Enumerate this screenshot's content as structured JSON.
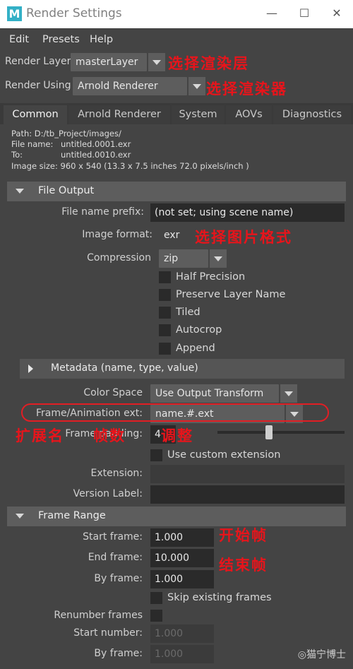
{
  "window": {
    "logo": "M",
    "title": "Render Settings",
    "minimize_glyph": "—",
    "maximize_glyph": "☐",
    "close_glyph": "✕"
  },
  "menubar": [
    "Edit",
    "Presets",
    "Help"
  ],
  "render_layer": {
    "label": "Render Layer",
    "value": "masterLayer"
  },
  "render_using": {
    "label": "Render Using",
    "value": "Arnold Renderer"
  },
  "annotations": {
    "layer": "选择渲染层",
    "renderer": "选择渲染器",
    "format": "选择图片格式",
    "ext_a": "扩展名",
    "ext_b": "帧数",
    "ext_c": "调整",
    "start": "开始帧",
    "end": "结束帧"
  },
  "tabs": [
    "Common",
    "Arnold Renderer",
    "System",
    "AOVs",
    "Diagnostics"
  ],
  "active_tab": "Common",
  "info": {
    "path": "Path: D:/tb_Project/images/",
    "file_name_label": "File name:",
    "file_name": "untitled.0001.exr",
    "to_label": "To:",
    "to": "untitled.0010.exr",
    "image_size": "Image size: 960 x 540 (13.3 x 7.5 inches 72.0 pixels/inch )"
  },
  "file_output": {
    "title": "File Output",
    "prefix_label": "File name prefix:",
    "prefix_value": "(not set; using scene name)",
    "format_label": "Image format:",
    "format_value": "exr",
    "compression_label": "Compression",
    "compression_value": "zip",
    "checkboxes": [
      "Half Precision",
      "Preserve Layer Name",
      "Tiled",
      "Autocrop",
      "Append"
    ],
    "metadata": "Metadata (name, type, value)",
    "color_space_label": "Color Space",
    "color_space_value": "Use Output Transform",
    "frame_ext_label": "Frame/Animation ext:",
    "frame_ext_value": "name.#.ext",
    "frame_padding_label": "Frame padding:",
    "frame_padding_value": "4",
    "custom_ext_label": "Use custom extension",
    "extension_label": "Extension:",
    "version_label": "Version Label:"
  },
  "frame_range": {
    "title": "Frame Range",
    "start_label": "Start frame:",
    "start_value": "1.000",
    "end_label": "End frame:",
    "end_value": "10.000",
    "by_label": "By frame:",
    "by_value": "1.000",
    "skip_label": "Skip existing frames",
    "renumber_label": "Renumber frames",
    "start_number_label": "Start number:",
    "start_number_value": "1.000",
    "renumber_by_label": "By frame:",
    "renumber_by_value": "1.000"
  },
  "watermark": "◎猫宁博士"
}
